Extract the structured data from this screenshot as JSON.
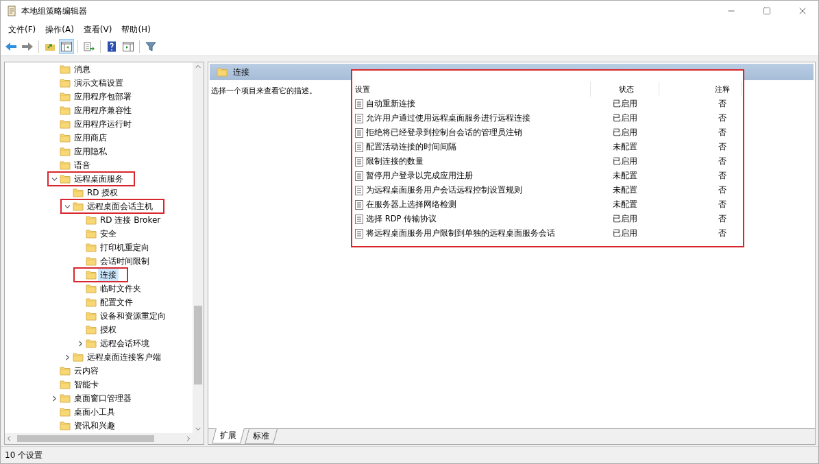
{
  "window": {
    "title": "本地组策略编辑器"
  },
  "menu": [
    "文件(F)",
    "操作(A)",
    "查看(V)",
    "帮助(H)"
  ],
  "tree": [
    {
      "label": "消息",
      "selected": false,
      "highlighted": false
    },
    {
      "label": "演示文稿设置",
      "selected": false,
      "highlighted": false
    },
    {
      "label": "应用程序包部署",
      "selected": false,
      "highlighted": false
    },
    {
      "label": "应用程序兼容性",
      "selected": false,
      "highlighted": false
    },
    {
      "label": "应用程序运行时",
      "selected": false,
      "highlighted": false
    },
    {
      "label": "应用商店",
      "selected": false,
      "highlighted": false
    },
    {
      "label": "应用隐私",
      "selected": false,
      "highlighted": false
    },
    {
      "label": "语音",
      "selected": false,
      "highlighted": false
    },
    {
      "label": "远程桌面服务",
      "expanded": true,
      "selected": false,
      "highlighted": true,
      "children": [
        {
          "label": "RD 授权",
          "selected": false,
          "highlighted": false
        },
        {
          "label": "远程桌面会话主机",
          "expanded": true,
          "selected": false,
          "highlighted": true,
          "children": [
            {
              "label": "RD 连接 Broker",
              "selected": false,
              "highlighted": false
            },
            {
              "label": "安全",
              "selected": false,
              "highlighted": false
            },
            {
              "label": "打印机重定向",
              "selected": false,
              "highlighted": false
            },
            {
              "label": "会话时间限制",
              "selected": false,
              "highlighted": false
            },
            {
              "label": "连接",
              "selected": true,
              "highlighted": true
            },
            {
              "label": "临时文件夹",
              "selected": false,
              "highlighted": false
            },
            {
              "label": "配置文件",
              "selected": false,
              "highlighted": false
            },
            {
              "label": "设备和资源重定向",
              "selected": false,
              "highlighted": false
            },
            {
              "label": "授权",
              "selected": false,
              "highlighted": false
            },
            {
              "label": "远程会话环境",
              "expanded": false,
              "selected": false,
              "highlighted": false
            }
          ]
        },
        {
          "label": "远程桌面连接客户端",
          "expanded": false,
          "selected": false,
          "highlighted": false
        }
      ]
    },
    {
      "label": "云内容",
      "selected": false,
      "highlighted": false
    },
    {
      "label": "智能卡",
      "selected": false,
      "highlighted": false
    },
    {
      "label": "桌面窗口管理器",
      "expanded": false,
      "selected": false,
      "highlighted": false
    },
    {
      "label": "桌面小工具",
      "selected": false,
      "highlighted": false
    },
    {
      "label": "资讯和兴趣",
      "selected": false,
      "highlighted": false
    }
  ],
  "pane": {
    "title": "连接",
    "description": "选择一个项目来查看它的描述。"
  },
  "table": {
    "highlighted": true,
    "columns": [
      "设置",
      "状态",
      "注释"
    ],
    "rows": [
      [
        "自动重新连接",
        "已启用",
        "否"
      ],
      [
        "允许用户通过使用远程桌面服务进行远程连接",
        "已启用",
        "否"
      ],
      [
        "拒绝将已经登录到控制台会话的管理员注销",
        "已启用",
        "否"
      ],
      [
        "配置活动连接的时间间隔",
        "未配置",
        "否"
      ],
      [
        "限制连接的数量",
        "已启用",
        "否"
      ],
      [
        "暂停用户登录以完成应用注册",
        "未配置",
        "否"
      ],
      [
        "为远程桌面服务用户会话远程控制设置规则",
        "未配置",
        "否"
      ],
      [
        "在服务器上选择网络检测",
        "未配置",
        "否"
      ],
      [
        "选择 RDP 传输协议",
        "已启用",
        "否"
      ],
      [
        "将远程桌面服务用户限制到单独的远程桌面服务会话",
        "已启用",
        "否"
      ]
    ]
  },
  "bottom_tabs": [
    {
      "label": "扩展",
      "selected": true
    },
    {
      "label": "标准",
      "selected": false
    }
  ],
  "status_bar": "10 个设置"
}
